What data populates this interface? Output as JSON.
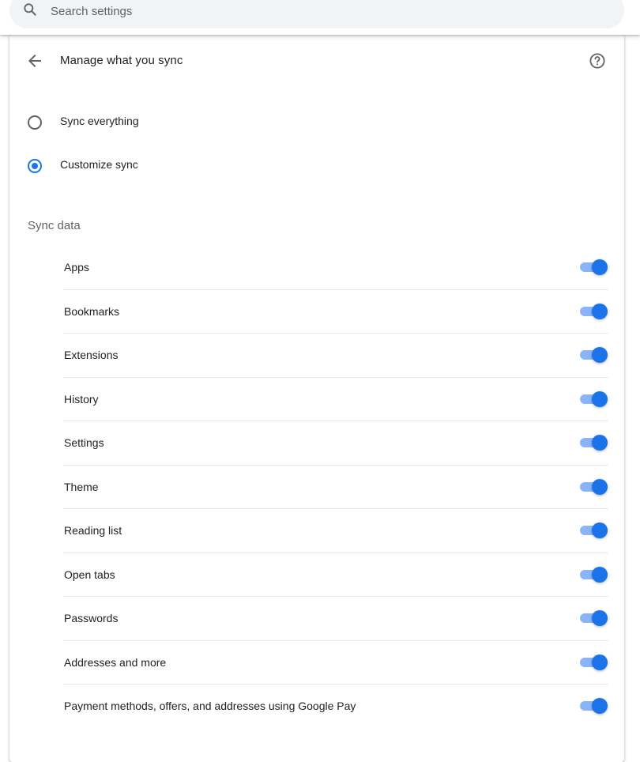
{
  "search": {
    "placeholder": "Search settings",
    "icon": "search-icon"
  },
  "header": {
    "title": "Manage what you sync",
    "back_icon": "arrow-back-icon",
    "help_icon": "help-icon"
  },
  "sync_mode": {
    "options": [
      {
        "label": "Sync everything",
        "checked": false
      },
      {
        "label": "Customize sync",
        "checked": true
      }
    ]
  },
  "sync_data": {
    "title": "Sync data",
    "items": [
      {
        "label": "Apps",
        "enabled": true
      },
      {
        "label": "Bookmarks",
        "enabled": true
      },
      {
        "label": "Extensions",
        "enabled": true
      },
      {
        "label": "History",
        "enabled": true
      },
      {
        "label": "Settings",
        "enabled": true
      },
      {
        "label": "Theme",
        "enabled": true
      },
      {
        "label": "Reading list",
        "enabled": true
      },
      {
        "label": "Open tabs",
        "enabled": true
      },
      {
        "label": "Passwords",
        "enabled": true
      },
      {
        "label": "Addresses and more",
        "enabled": true
      },
      {
        "label": "Payment methods, offers, and addresses using Google Pay",
        "enabled": true
      }
    ]
  },
  "colors": {
    "accent": "#1a73e8",
    "toggle_track": "#8ab4f8",
    "secondary_text": "#5f6368"
  }
}
